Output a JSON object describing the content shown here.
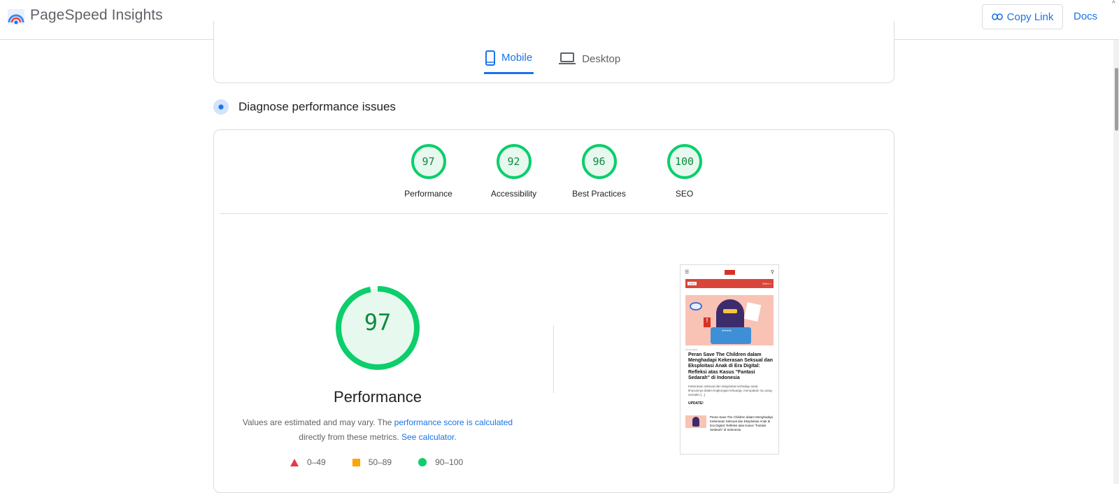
{
  "header": {
    "brand": "PageSpeed Insights",
    "copy_link": "Copy Link",
    "docs": "Docs",
    "caret": "^"
  },
  "tabs": [
    {
      "label": "Mobile",
      "icon": "smartphone-icon",
      "active": true
    },
    {
      "label": "Desktop",
      "icon": "laptop-icon",
      "active": false
    }
  ],
  "diagnose": {
    "title": "Diagnose performance issues"
  },
  "categories": [
    {
      "score": "97",
      "label": "Performance"
    },
    {
      "score": "92",
      "label": "Accessibility"
    },
    {
      "score": "96",
      "label": "Best Practices"
    },
    {
      "score": "100",
      "label": "SEO"
    }
  ],
  "performance": {
    "score": "97",
    "score_fraction": 0.97,
    "title": "Performance",
    "desc_prefix": "Values are estimated and may vary. The ",
    "desc_link1": "performance score is calculated",
    "desc_mid": " directly from these metrics. ",
    "desc_link2": "See calculator.",
    "legend": [
      {
        "range": "0–49",
        "color": "#e63946"
      },
      {
        "range": "50–89",
        "color": "#ffa400"
      },
      {
        "range": "90–100",
        "color": "#0cce6b"
      }
    ]
  },
  "colors": {
    "accent": "#1a73e8",
    "pass": "#0cce6b",
    "pass_text": "#0d8a3e"
  },
  "screenshot": {
    "bar_left": "SIKS",
    "bar_right": "Kirim »",
    "date": "13 Juni 2024",
    "article_title": "Peran Save The Children dalam Menghadapi Kekerasan Seksual dan Eksploitasi Anak di Era Digital: Refleksi atas Kasus \"Fantasi Sedarah\" di Indonesia",
    "excerpt": "Kekerasan seksual dan eksploitasi terhadap anak, khususnya dalam lingkungan keluarga, merupakan isu yang semakin [...]",
    "update": "UPDATE!",
    "item_text": "Peran Save The Children dalam Menghadapi Kekerasan Seksual dan Eksploitasi Anak di Era Digital: Refleksi atas Kasus \"Fantasi Sedarah\" di Indonesia",
    "password_mask": "******"
  }
}
